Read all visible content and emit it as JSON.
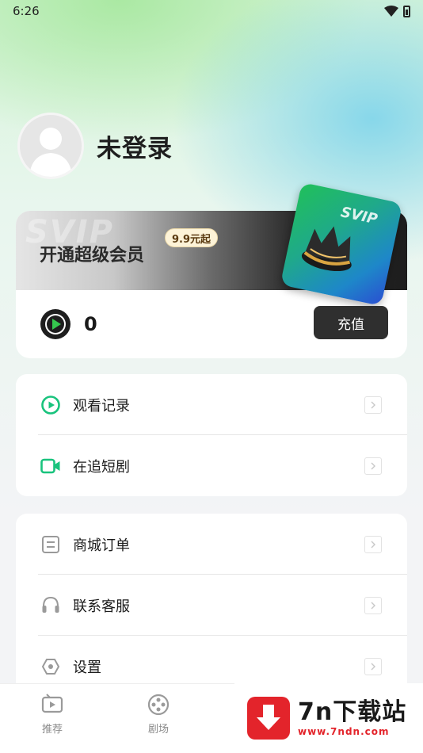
{
  "status_bar": {
    "time": "6:26"
  },
  "profile": {
    "username": "未登录"
  },
  "vip": {
    "watermark": "SVIP",
    "title": "开通超级会员",
    "price_badge": "9.9元起",
    "card_label": "SVIP"
  },
  "balance": {
    "value": "0",
    "recharge_label": "充值"
  },
  "menu_group_1": [
    {
      "label": "观看记录",
      "icon": "play-history-icon"
    },
    {
      "label": "在追短剧",
      "icon": "video-camera-icon"
    }
  ],
  "menu_group_2": [
    {
      "label": "商城订单",
      "icon": "order-list-icon"
    },
    {
      "label": "联系客服",
      "icon": "headset-icon"
    },
    {
      "label": "设置",
      "icon": "settings-hexagon-icon"
    }
  ],
  "bottom_nav": [
    {
      "label": "推荐",
      "icon": "recommend-tv-icon"
    },
    {
      "label": "剧场",
      "icon": "film-reel-icon"
    }
  ],
  "watermark": {
    "title": "7n下载站",
    "url": "www.7ndn.com"
  },
  "colors": {
    "accent_green": "#19c37d",
    "dark_button": "#2f2f2f",
    "brand_red": "#e3242b"
  }
}
